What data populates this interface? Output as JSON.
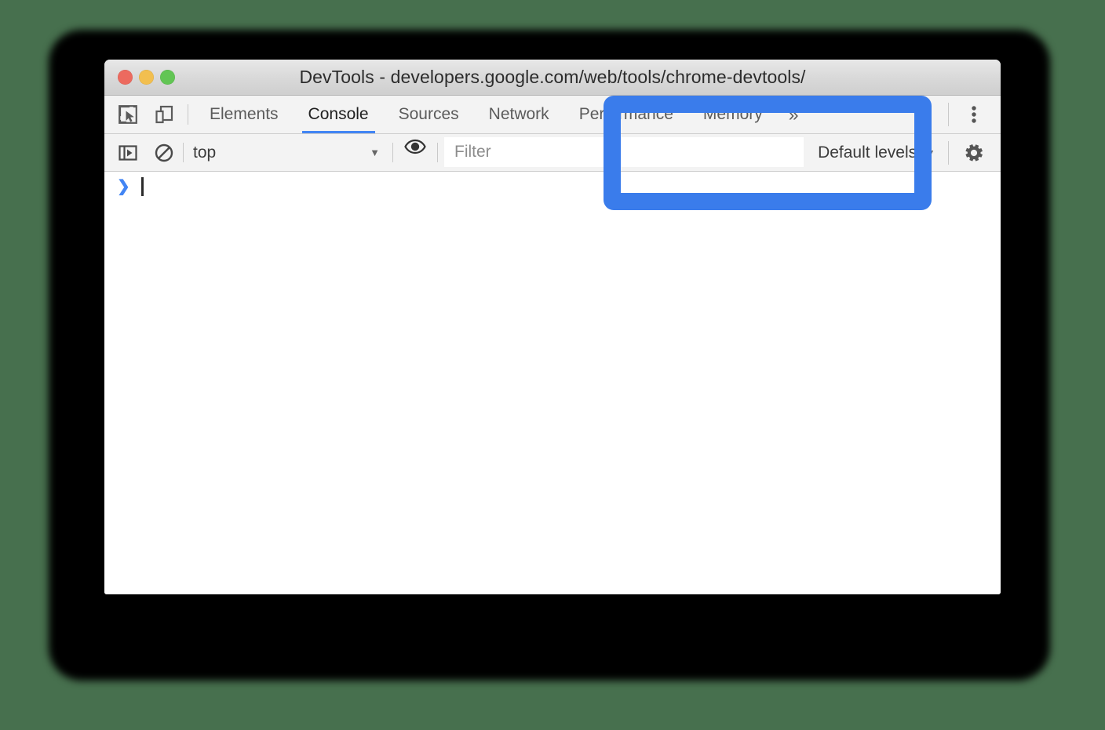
{
  "window": {
    "title": "DevTools - developers.google.com/web/tools/chrome-devtools/",
    "traffic_lights": [
      {
        "name": "close",
        "color": "#ec6a5f"
      },
      {
        "name": "minimize",
        "color": "#f2bf4f"
      },
      {
        "name": "maximize",
        "color": "#62c554"
      }
    ]
  },
  "toolbar": {
    "inspect_icon": "inspect-element-icon",
    "device_icon": "device-toolbar-icon",
    "more_icon": "kebab-menu-icon",
    "tabs": [
      {
        "label": "Elements",
        "active": false
      },
      {
        "label": "Console",
        "active": true
      },
      {
        "label": "Sources",
        "active": false
      },
      {
        "label": "Network",
        "active": false
      },
      {
        "label": "Performance",
        "active": false
      },
      {
        "label": "Memory",
        "active": false
      }
    ],
    "overflow_label": "»"
  },
  "filterbar": {
    "sidebar_icon": "console-sidebar-icon",
    "clear_icon": "clear-console-icon",
    "context": "top",
    "context_caret": "▼",
    "eye_icon": "live-expression-icon",
    "filter_placeholder": "Filter",
    "filter_value": "",
    "levels_label": "Default levels",
    "levels_caret": "▼",
    "settings_icon": "settings-gear-icon"
  },
  "console": {
    "prompt_chevron": "❯",
    "input_value": ""
  },
  "annotation": {
    "highlight_color": "#3a7ceb",
    "shape": "rounded-rectangle-outline"
  },
  "colors": {
    "page_background": "#47704e",
    "accent_blue": "#4285f4",
    "toolbar_background": "#f3f3f3",
    "console_background": "#ffffff"
  }
}
